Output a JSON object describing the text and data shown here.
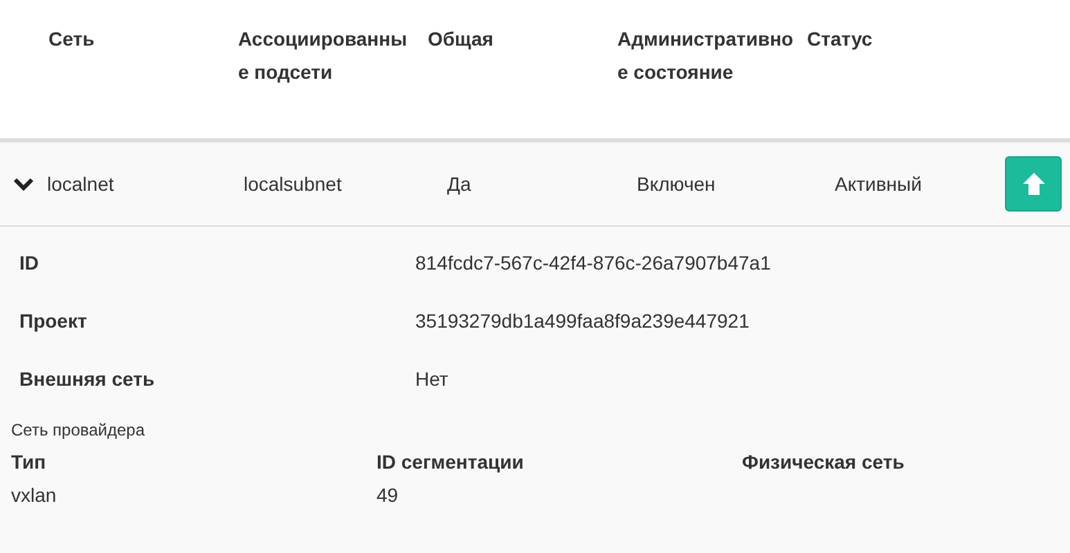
{
  "table": {
    "columns": [
      "Сеть",
      "Ассоциированные подсети",
      "Общая",
      "Административное состояние",
      "Статус"
    ],
    "rows": [
      {
        "expanded": true,
        "cells": [
          "localnet",
          "localsubnet",
          "Да",
          "Включен",
          "Активный"
        ],
        "details": {
          "fields": [
            {
              "label": "ID",
              "value": "814fcdc7-567c-42f4-876c-26a7907b47a1"
            },
            {
              "label": "Проект",
              "value": "35193279db1a499faa8f9a239e447921"
            },
            {
              "label": "Внешняя сеть",
              "value": "Нет"
            }
          ],
          "provider": {
            "title": "Сеть провайдера",
            "columns": [
              "Тип",
              "ID сегментации",
              "Физическая сеть"
            ],
            "values": [
              "vxlan",
              "49"
            ]
          }
        }
      }
    ]
  }
}
